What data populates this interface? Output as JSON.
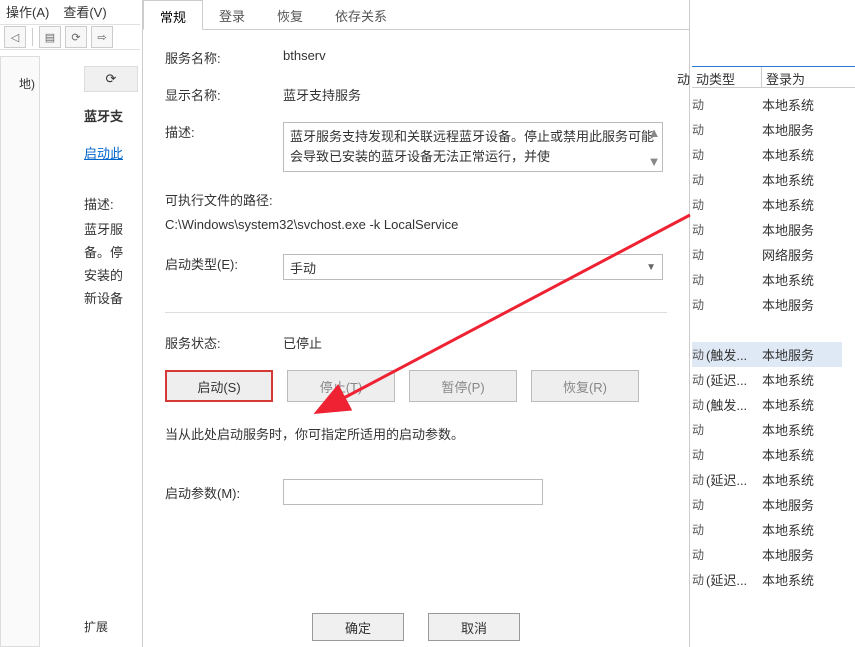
{
  "topmenu": {
    "op": "操作(A)",
    "view": "查看(V)"
  },
  "leftstrip": {
    "cut": "地)"
  },
  "leftpanel": {
    "hdr_icon": "⟳",
    "title": "蓝牙支",
    "link": "启动此",
    "desc_lbl": "描述:",
    "d1": "蓝牙服",
    "d2": "备。停",
    "d3": "安装的",
    "d4": "新设备",
    "ext": "扩展"
  },
  "dialog": {
    "tabs": {
      "general": "常规",
      "logon": "登录",
      "recovery": "恢复",
      "deps": "依存关系"
    },
    "service_name_lbl": "服务名称:",
    "service_name": "bthserv",
    "display_name_lbl": "显示名称:",
    "display_name": "蓝牙支持服务",
    "desc_lbl": "描述:",
    "desc_text": "蓝牙服务支持发现和关联远程蓝牙设备。停止或禁用此服务可能会导致已安装的蓝牙设备无法正常运行，并使",
    "path_lbl": "可执行文件的路径:",
    "path_val": "C:\\Windows\\system32\\svchost.exe -k LocalService",
    "startup_lbl": "启动类型(E):",
    "startup_val": "手动",
    "state_lbl": "服务状态:",
    "state_val": "已停止",
    "btn_start": "启动(S)",
    "btn_stop": "停止(T)",
    "btn_pause": "暂停(P)",
    "btn_resume": "恢复(R)",
    "hint": "当从此处启动服务时，你可指定所适用的启动参数。",
    "param_lbl": "启动参数(M):",
    "ok": "确定",
    "cancel": "取消"
  },
  "rtable": {
    "hdr_cut": "动",
    "hdr_type": "动类型",
    "hdr_logon": "登录为",
    "rows": [
      {
        "c0": "动",
        "c1": "",
        "c2": "本地系统"
      },
      {
        "c0": "动",
        "c1": "",
        "c2": "本地服务"
      },
      {
        "c0": "动",
        "c1": "",
        "c2": "本地系统"
      },
      {
        "c0": "动",
        "c1": "",
        "c2": "本地系统"
      },
      {
        "c0": "动",
        "c1": "",
        "c2": "本地系统"
      },
      {
        "c0": "动",
        "c1": "",
        "c2": "本地服务"
      },
      {
        "c0": "动",
        "c1": "",
        "c2": "网络服务"
      },
      {
        "c0": "动",
        "c1": "",
        "c2": "本地系统"
      },
      {
        "c0": "动",
        "c1": "",
        "c2": "本地服务"
      },
      {
        "c0": "",
        "c1": "",
        "c2": ""
      },
      {
        "c0": "动",
        "c1": "(触发...",
        "c2": "本地服务",
        "sel": true
      },
      {
        "c0": "动",
        "c1": "(延迟...",
        "c2": "本地系统"
      },
      {
        "c0": "动",
        "c1": "(触发...",
        "c2": "本地系统"
      },
      {
        "c0": "动",
        "c1": "",
        "c2": "本地系统"
      },
      {
        "c0": "动",
        "c1": "",
        "c2": "本地系统"
      },
      {
        "c0": "动",
        "c1": "(延迟...",
        "c2": "本地系统"
      },
      {
        "c0": "动",
        "c1": "",
        "c2": "本地服务"
      },
      {
        "c0": "动",
        "c1": "",
        "c2": "本地系统"
      },
      {
        "c0": "动",
        "c1": "",
        "c2": "本地服务"
      },
      {
        "c0": "动",
        "c1": "(延迟...",
        "c2": "本地系统"
      }
    ]
  }
}
